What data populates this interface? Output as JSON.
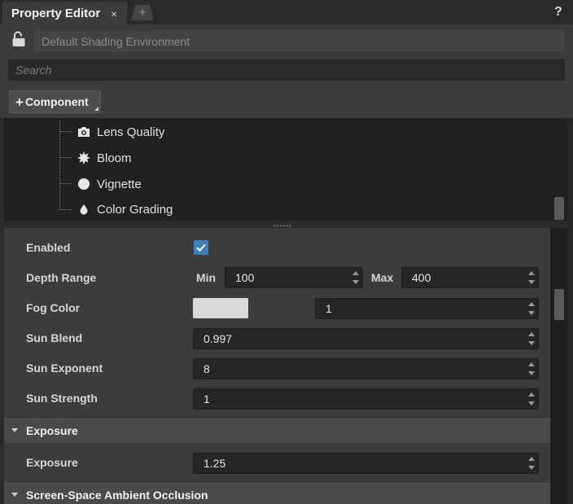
{
  "window": {
    "tab_title": "Property Editor",
    "tab_close": "×",
    "new_tab_glyph": "+",
    "help": "?"
  },
  "header": {
    "lock_icon": "lock-open-icon",
    "environment_name": "Default Shading Environment",
    "search_placeholder": "Search",
    "component_button": "Component",
    "component_plus": "+"
  },
  "tree": {
    "items": [
      {
        "label": "Lens Quality",
        "icon": "camera-icon"
      },
      {
        "label": "Bloom",
        "icon": "bloom-icon"
      },
      {
        "label": "Vignette",
        "icon": "circle-icon"
      },
      {
        "label": "Color Grading",
        "icon": "droplet-icon"
      }
    ]
  },
  "properties": {
    "enabled": {
      "label": "Enabled",
      "checked": true
    },
    "depth_range": {
      "label": "Depth Range",
      "min_label": "Min",
      "min_value": "100",
      "max_label": "Max",
      "max_value": "400"
    },
    "fog_color": {
      "label": "Fog Color",
      "swatch_color": "#d9d9d9",
      "value": "1"
    },
    "sun_blend": {
      "label": "Sun Blend",
      "value": "0.997"
    },
    "sun_exponent": {
      "label": "Sun Exponent",
      "value": "8"
    },
    "sun_strength": {
      "label": "Sun Strength",
      "value": "1"
    }
  },
  "sections": {
    "exposure": {
      "title": "Exposure",
      "exposure_label": "Exposure",
      "exposure_value": "1.25"
    },
    "ssao": {
      "title": "Screen-Space Ambient Occlusion"
    }
  },
  "colors": {
    "accent": "#3f7fb5",
    "panel": "#3c3c3c",
    "tree_bg": "#212121"
  }
}
